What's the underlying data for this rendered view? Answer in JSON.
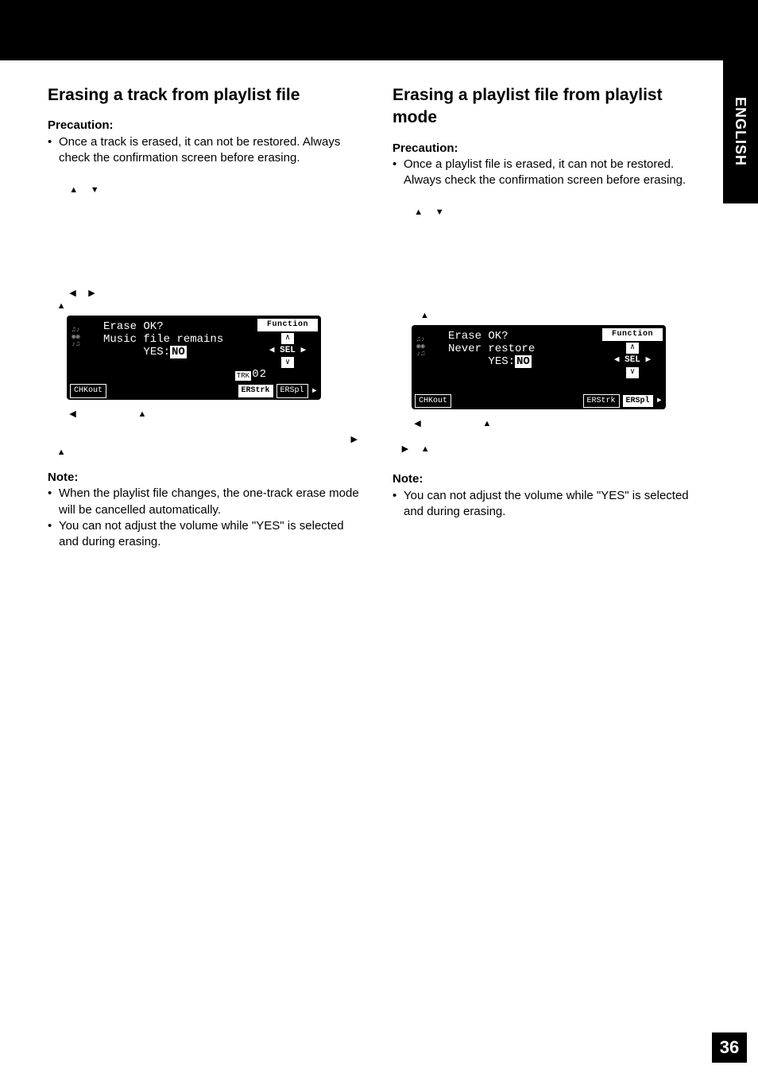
{
  "side_tab": "ENGLISH",
  "page_number": "36",
  "left": {
    "heading": "Erasing a track from playlist file",
    "precaution_label": "Precaution:",
    "precaution_text": "Once a track is erased, it can not be restored. Always check the confirmation screen before erasing.",
    "lcd": {
      "line1": "Erase OK?",
      "line2": "Music file remains",
      "line3_prefix": "YES:",
      "line3_no": "NO",
      "function": "Function",
      "sel": "SEL",
      "trk_label": "TRK",
      "trk_num": "02",
      "chk": "CHKout",
      "ers_trk": "ERStrk",
      "ers_pl": "ERSpl"
    },
    "note_label": "Note:",
    "notes": [
      "When the playlist file changes, the one-track erase mode will be cancelled automatically.",
      "You can not adjust the volume while \"YES\" is selected and during erasing."
    ]
  },
  "right": {
    "heading": "Erasing a playlist file from playlist mode",
    "precaution_label": "Precaution:",
    "precaution_text": "Once a playlist file is erased, it can not be restored. Always check the confirmation screen before erasing.",
    "lcd": {
      "line1": "Erase OK?",
      "line2": "Never restore",
      "line3_prefix": "YES:",
      "line3_no": "NO",
      "function": "Function",
      "sel": "SEL",
      "chk": "CHKout",
      "ers_trk": "ERStrk",
      "ers_pl": "ERSpl"
    },
    "note_label": "Note:",
    "notes": [
      "You can not adjust the volume while \"YES\" is selected and during erasing."
    ]
  }
}
